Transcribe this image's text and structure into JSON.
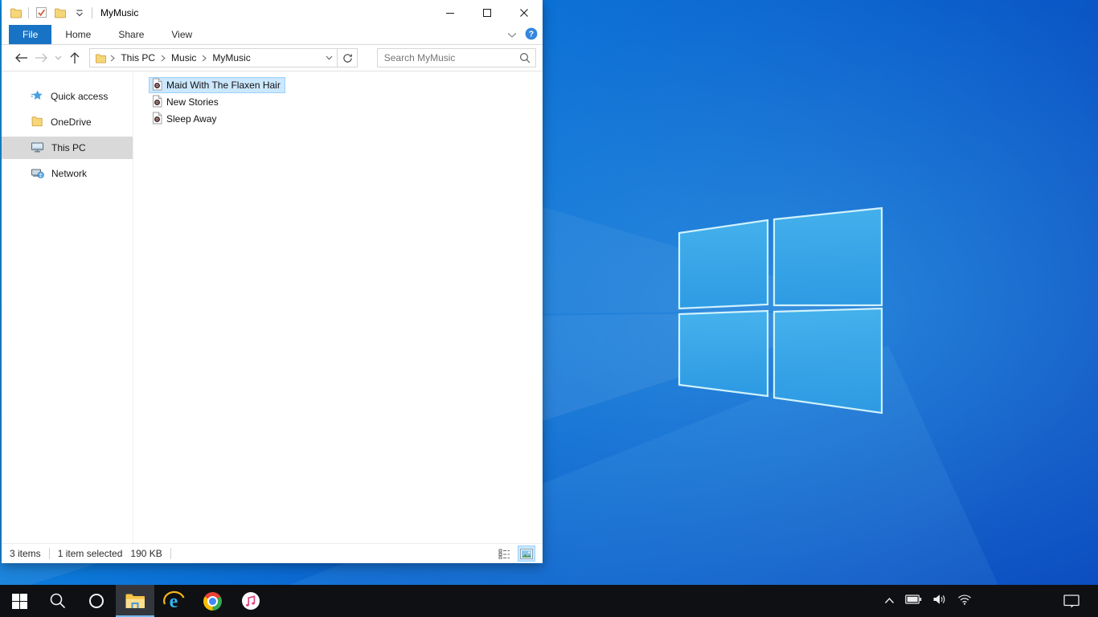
{
  "window": {
    "title": "MyMusic",
    "tabs": [
      {
        "label": "File",
        "active": true
      },
      {
        "label": "Home",
        "active": false
      },
      {
        "label": "Share",
        "active": false
      },
      {
        "label": "View",
        "active": false
      }
    ],
    "navigation": {
      "breadcrumb": [
        "This PC",
        "Music",
        "MyMusic"
      ],
      "search_placeholder": "Search MyMusic"
    },
    "sidebar": [
      {
        "label": "Quick access",
        "icon": "quick-access-star",
        "selected": false
      },
      {
        "label": "OneDrive",
        "icon": "onedrive-folder",
        "selected": false
      },
      {
        "label": "This PC",
        "icon": "this-pc-monitor",
        "selected": true
      },
      {
        "label": "Network",
        "icon": "network-computer",
        "selected": false
      }
    ],
    "files": [
      {
        "name": "Maid With The Flaxen Hair",
        "icon": "audio-file",
        "selected": true
      },
      {
        "name": "New Stories",
        "icon": "audio-file",
        "selected": false
      },
      {
        "name": "Sleep Away",
        "icon": "audio-file",
        "selected": false
      }
    ],
    "status_bar": {
      "items_count": "3 items",
      "selected_count": "1 item selected",
      "selected_size": "190 KB"
    }
  },
  "taskbar": {
    "buttons": [
      "start",
      "search",
      "cortana",
      "file-explorer",
      "internet-explorer",
      "chrome",
      "itunes"
    ],
    "active_button": "file-explorer",
    "tray": [
      "hidden-icons",
      "battery",
      "volume",
      "wifi",
      "action-center"
    ]
  },
  "icons": {
    "help_glyph": "?",
    "ie_glyph": "e"
  },
  "colors": {
    "accent_tab_blue": "#1973c5",
    "file_selection_fill": "#cce8ff",
    "file_selection_border": "#99d1ff",
    "sidebar_selection": "#d9d9d9",
    "taskbar_bg": "#0f1013",
    "taskbar_active_underline": "#76b9ed",
    "desktop_gradient_left": "#0d8ce2",
    "desktop_gradient_right": "#0a4cc0"
  }
}
